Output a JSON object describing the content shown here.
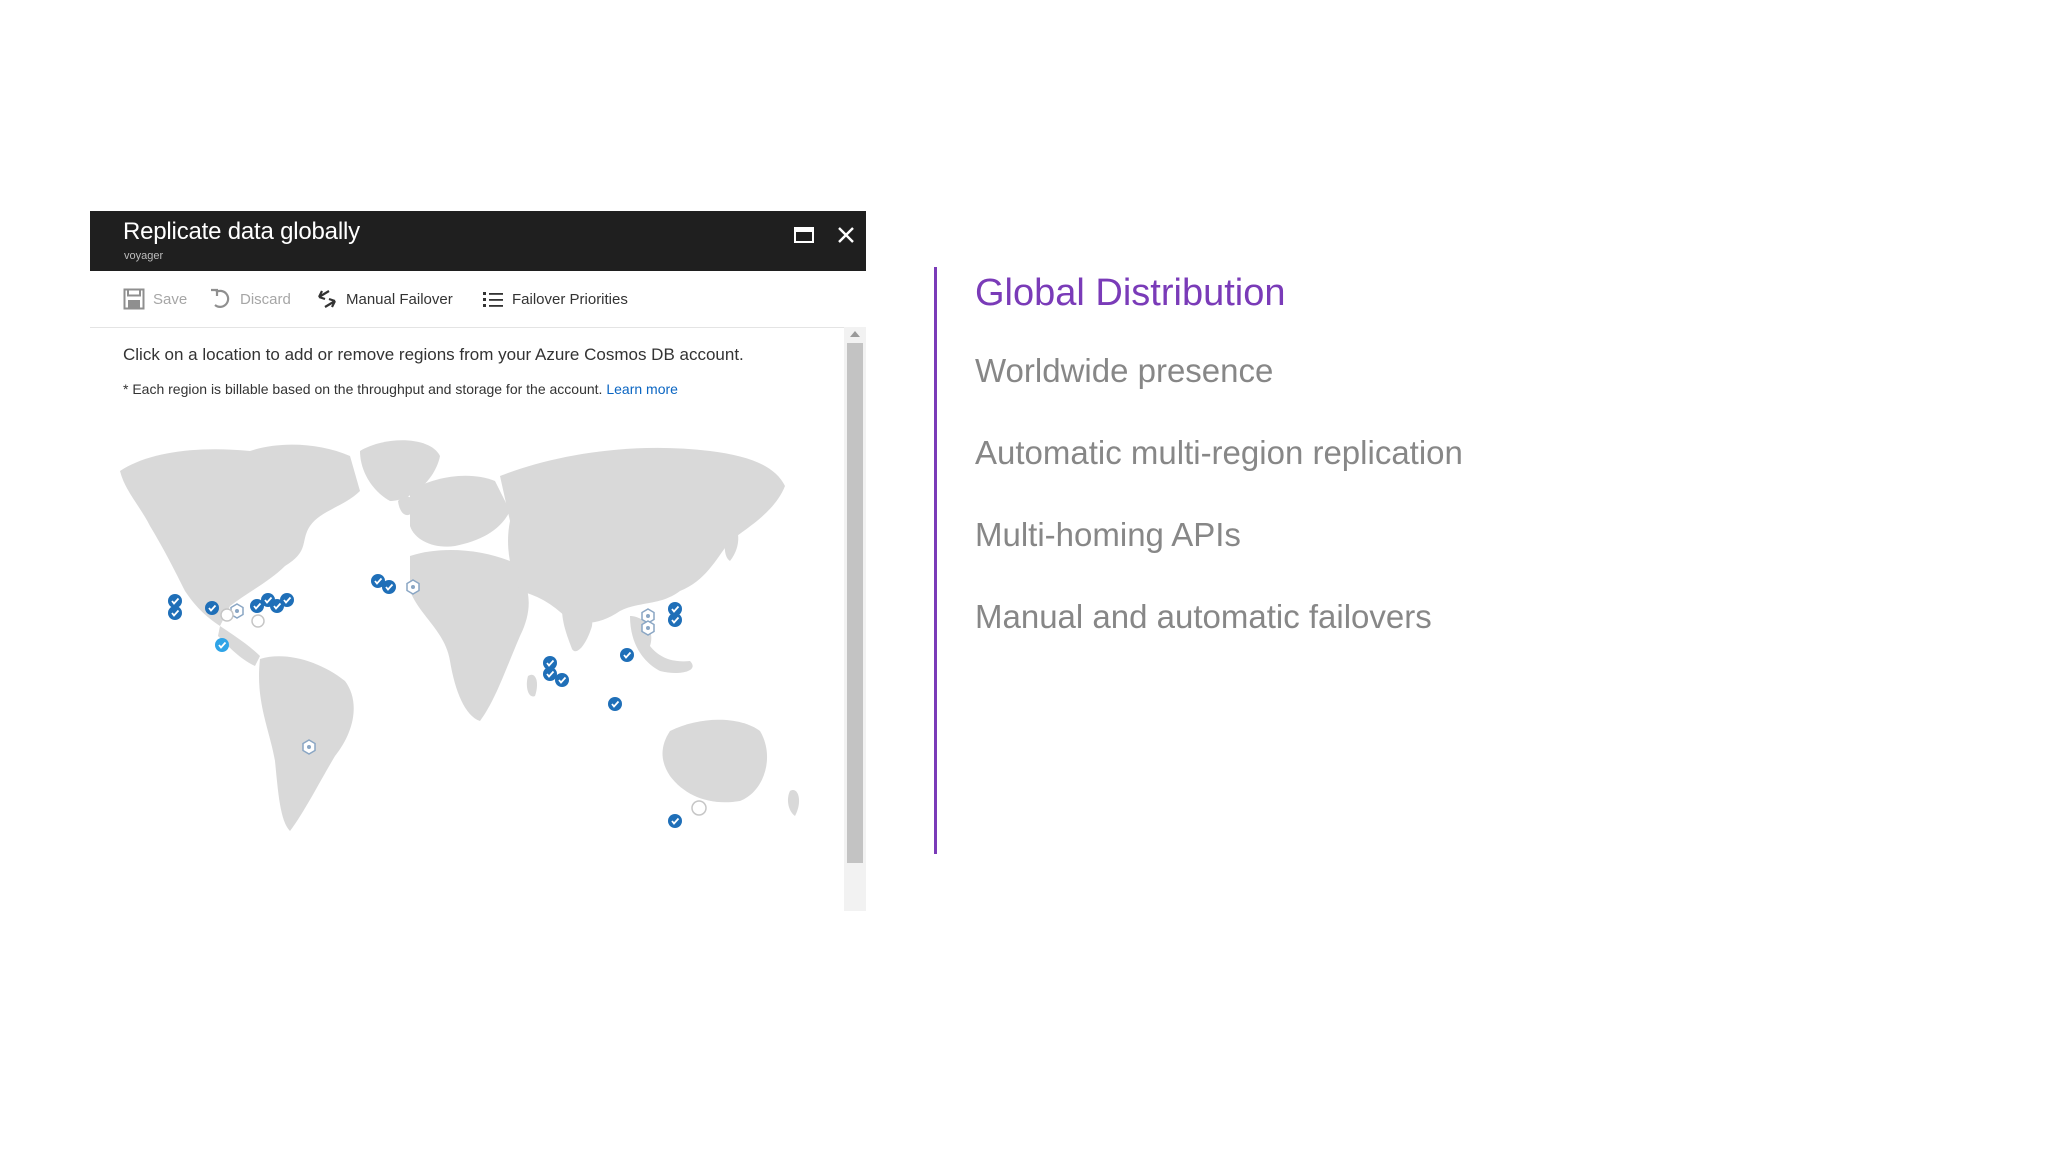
{
  "blade": {
    "title": "Replicate data globally",
    "subtitle": "voyager",
    "toolbar": {
      "save": "Save",
      "discard": "Discard",
      "manual_failover": "Manual Failover",
      "failover_priorities": "Failover Priorities"
    },
    "instruction": "Click on a location to add or remove regions from your Azure Cosmos DB account.",
    "note": "* Each region is billable based on the throughput and storage for the account.",
    "learn_more": "Learn more"
  },
  "right": {
    "heading": "Global Distribution",
    "bullets": [
      "Worldwide presence",
      "Automatic multi-region replication",
      "Multi-homing APIs",
      "Manual and automatic failovers"
    ]
  },
  "colors": {
    "accent": "#7a3bb8",
    "selected_region": "#1f6fb8",
    "write_region": "#2fa4e7",
    "available_region": "#a9b9c9",
    "land": "#d8d8d8"
  },
  "map": {
    "icons": {
      "selected": "checkmark-pin-icon",
      "write": "write-region-pin-icon",
      "available": "hexagon-add-icon",
      "unavailable": "empty-circle-icon"
    }
  }
}
